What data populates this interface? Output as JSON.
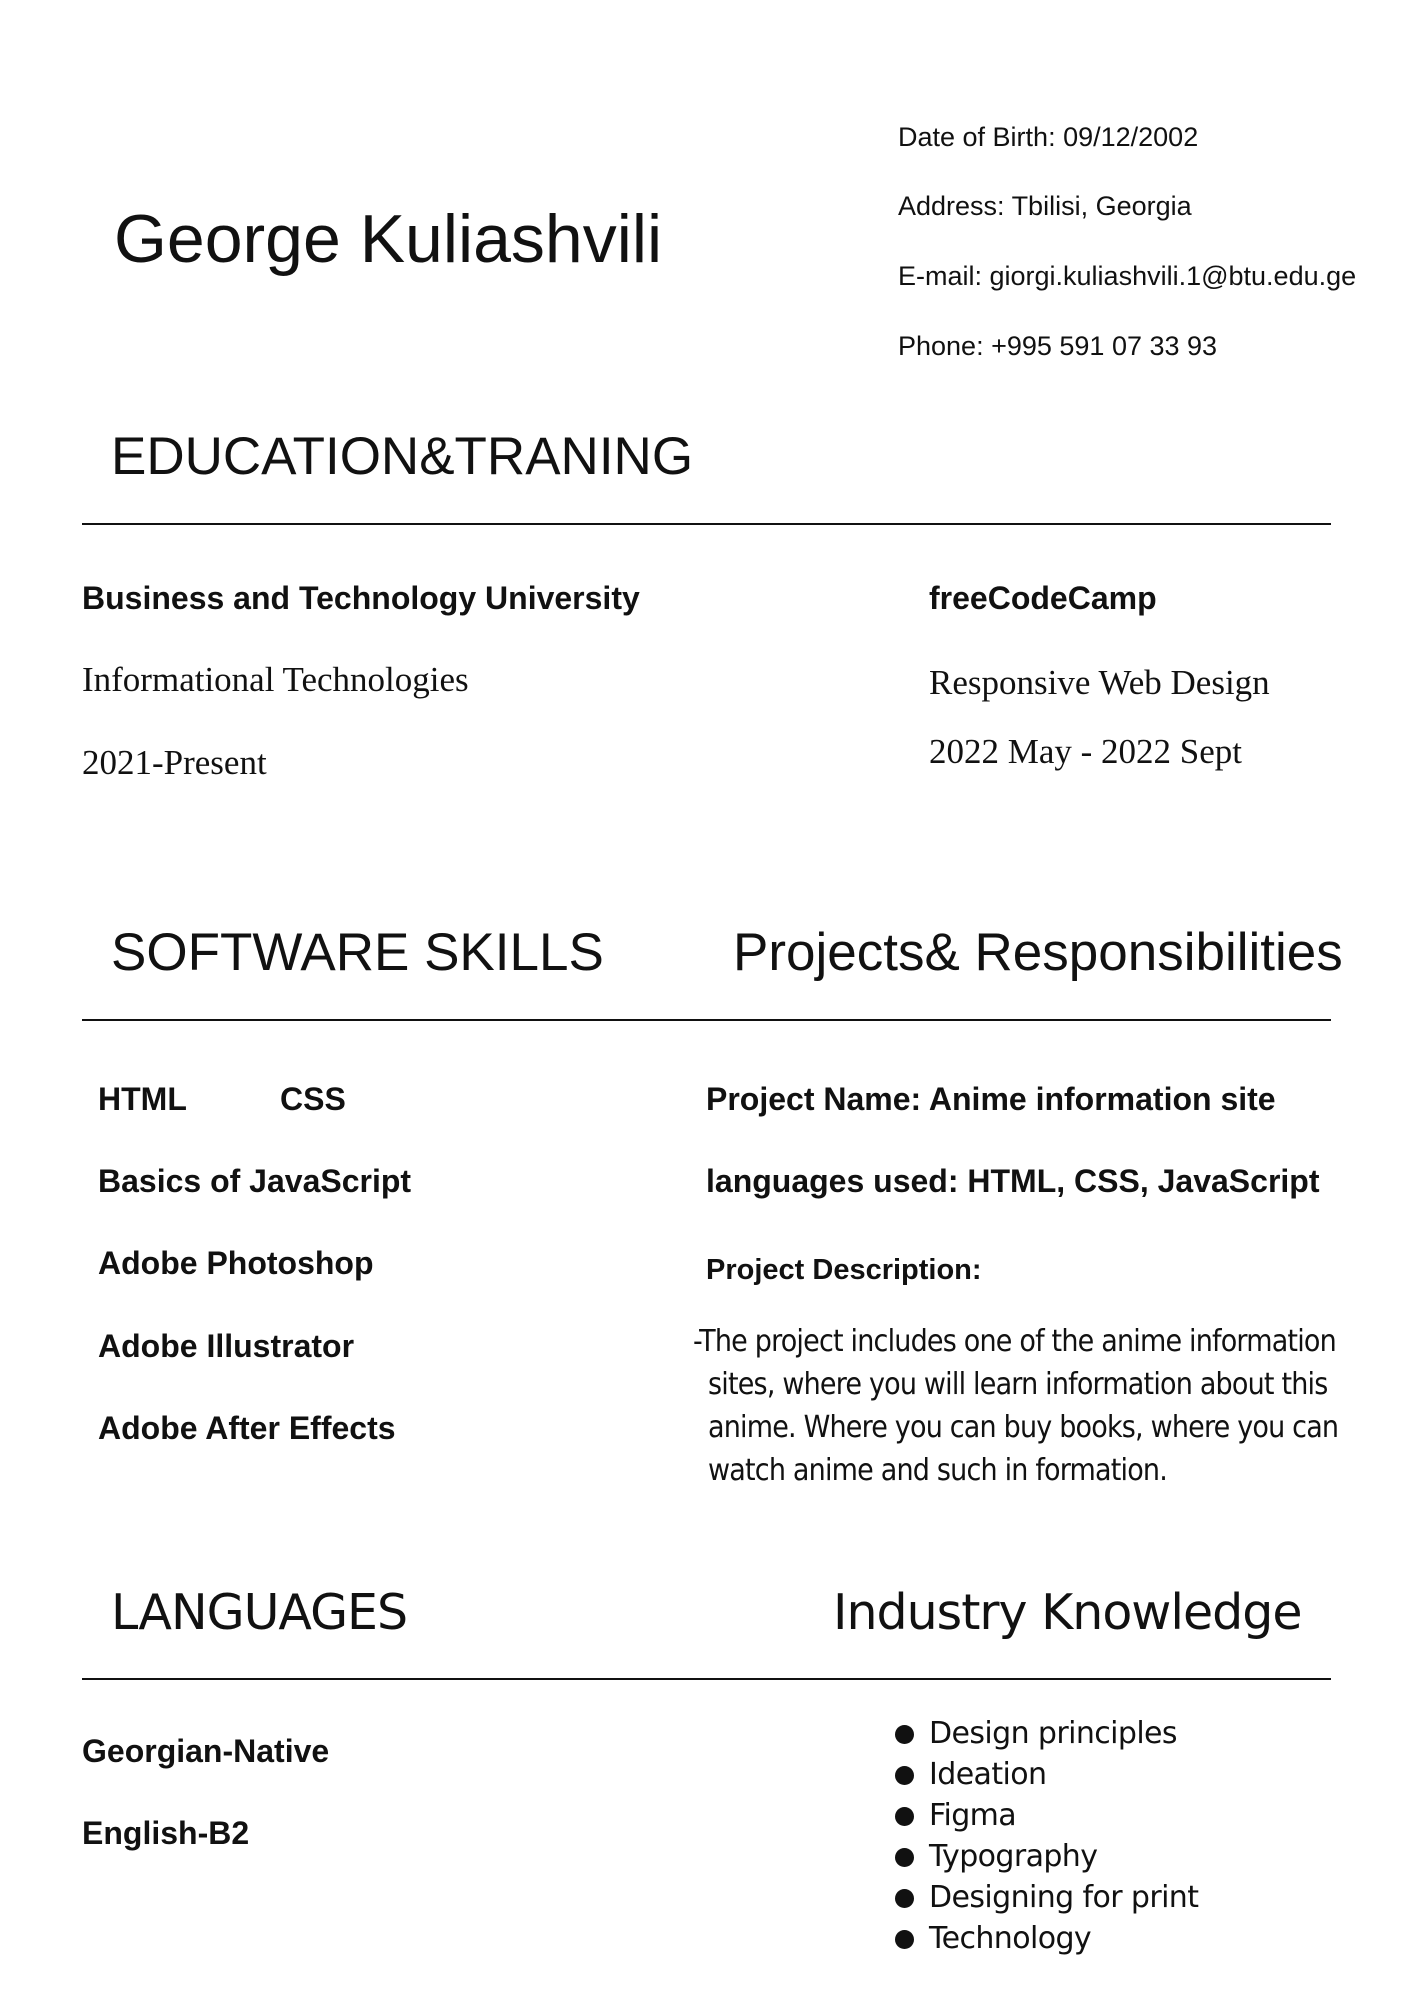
{
  "header": {
    "name": "George Kuliashvili",
    "contact": [
      "Date of Birth: 09/12/2002",
      "Address: Tbilisi, Georgia",
      "E-mail: giorgi.kuliashvili.1@btu.edu.ge",
      "Phone: +995 591 07 33 93"
    ]
  },
  "education": {
    "title": "EDUCATION&TRANING",
    "entries": [
      {
        "institution": "Business and Technology University",
        "field": "Informational Technologies",
        "period": "2021-Present"
      },
      {
        "institution": "freeCodeCamp",
        "field": "Responsive Web Design",
        "period": "2022 May - 2022 Sept"
      }
    ]
  },
  "skills": {
    "title": "SOFTWARE SKILLS",
    "items": [
      "HTML",
      "CSS",
      "Basics of JavaScript",
      "Adobe Photoshop",
      "Adobe Illustrator",
      "Adobe After Effects"
    ]
  },
  "projects": {
    "title": "Projects& Responsibilities",
    "name_line": "Project Name: Anime information site",
    "languages_line": "languages used: HTML, CSS, JavaScript",
    "description_label": "Project Description:",
    "description_lines": [
      "-The project includes one of the anime information",
      "sites, where you will learn information about this",
      "anime. Where you can buy books, where you can",
      "watch anime and such in formation."
    ]
  },
  "languages": {
    "title": "LANGUAGES",
    "items": [
      "Georgian-Native",
      "English-B2"
    ]
  },
  "industry": {
    "title": "Industry Knowledge",
    "items": [
      "Design principles",
      "Ideation",
      "Figma",
      "Typography",
      "Designing for print",
      "Technology"
    ]
  }
}
